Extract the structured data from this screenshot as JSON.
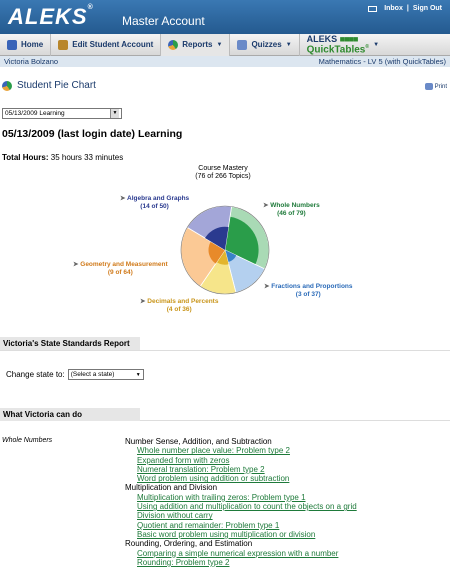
{
  "header": {
    "logo": "ALEKS",
    "logo_mark": "®",
    "account": "Master Account",
    "inbox": "Inbox",
    "signout": "Sign Out",
    "sep": "|"
  },
  "nav": {
    "home": "Home",
    "edit_student": "Edit Student Account",
    "reports": "Reports",
    "quizzes": "Quizzes",
    "quicktables_top": "ALEKS",
    "quicktables_bottom": "QuickTables",
    "quicktables_mark": "®"
  },
  "subheader": {
    "student": "Victoria Bolzano",
    "course": "Mathematics - LV 5 (with QuickTables)"
  },
  "page": {
    "title": "Student Pie Chart",
    "print": "Print",
    "date_select": "05/13/2009 Learning",
    "heading": "05/13/2009 (last login date) Learning",
    "total_hours_label": "Total Hours:",
    "total_hours_value": "35 hours 33 minutes"
  },
  "pie": {
    "title_line1": "Course Mastery",
    "title_line2": "(76 of 266 Topics)",
    "slices": [
      {
        "name": "Whole Numbers",
        "count": "(46 of 79)",
        "color": "#2a9d4a",
        "light": "#a9dab5"
      },
      {
        "name": "Fractions and Proportions",
        "count": "(3 of 37)",
        "color": "#3a82c8",
        "light": "#b4d0ef"
      },
      {
        "name": "Decimals and Percents",
        "count": "(4 of 36)",
        "color": "#e3b52c",
        "light": "#f6e58a"
      },
      {
        "name": "Geometry and Measurement",
        "count": "(9 of 64)",
        "color": "#e88a2a",
        "light": "#fbc995"
      },
      {
        "name": "Algebra and Graphs",
        "count": "(14 of 50)",
        "color": "#2a3a8f",
        "light": "#a3a6d8"
      }
    ]
  },
  "state_report": {
    "title": "Victoria's State Standards Report",
    "label": "Change state to:",
    "select": "(Select a state)"
  },
  "can_do": {
    "title": "What Victoria can do",
    "category": "Whole Numbers",
    "groups": [
      {
        "heading": "Number Sense, Addition, and Subtraction",
        "items": [
          "Whole number place value: Problem type 2",
          "Expanded form with zeros",
          "Numeral translation: Problem type 2",
          "Word problem using addition or subtraction"
        ]
      },
      {
        "heading": "Multiplication and Division",
        "items": [
          "Multiplication with trailing zeros: Problem type 1",
          "Using addition and multiplication to count the objects on a grid",
          "Division without carry",
          "Quotient and remainder: Problem type 1",
          "Basic word problem using multiplication or division"
        ]
      },
      {
        "heading": "Rounding, Ordering, and Estimation",
        "items": [
          "Comparing a simple numerical expression with a number",
          "Rounding: Problem type 2"
        ]
      }
    ]
  }
}
